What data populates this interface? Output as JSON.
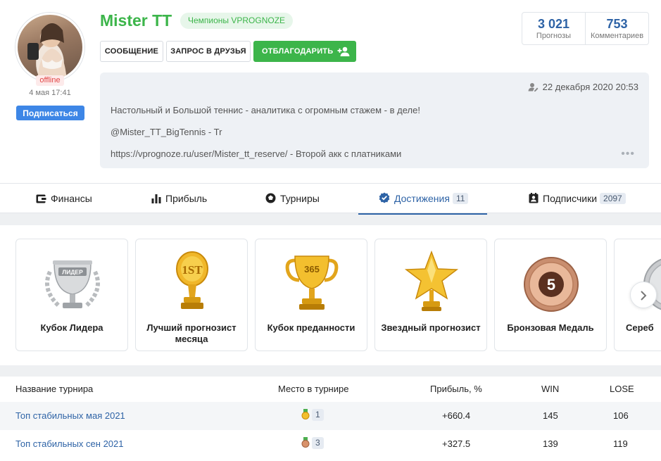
{
  "profile": {
    "username": "Mister TT",
    "status_badge": "Чемпионы VPROGNOZE",
    "online_status": "offline",
    "last_seen": "4 мая 17:41",
    "subscribe_label": "Подписаться",
    "buttons": {
      "message": "СООБЩЕНИЕ",
      "friend_request": "ЗАПРОС В ДРУЗЬЯ",
      "thank": "ОТБЛАГОДАРИТЬ"
    },
    "stats": [
      {
        "value": "3 021",
        "label": "Прогнозы"
      },
      {
        "value": "753",
        "label": "Комментариев"
      }
    ],
    "about": {
      "date": "22 декабря 2020 20:53",
      "lines": [
        "Настольный и Большой теннис - аналитика с огромным стажем - в деле!",
        "@Mister_TT_BigTennis - Tr",
        "https://vprognoze.ru/user/Mister_tt_reserve/ - Второй акк с платниками"
      ],
      "more": "•••"
    }
  },
  "tabs": [
    {
      "label": "Финансы",
      "icon": "wallet-icon"
    },
    {
      "label": "Прибыль",
      "icon": "bar-chart-icon"
    },
    {
      "label": "Турниры",
      "icon": "soccer-ball-icon"
    },
    {
      "label": "Достижения",
      "icon": "verified-badge-icon",
      "count": "11",
      "active": true
    },
    {
      "label": "Подписчики",
      "icon": "contact-card-icon",
      "count": "2097"
    }
  ],
  "achievements": [
    {
      "name": "Кубок Лидера",
      "icon": "silver-leader-cup-icon"
    },
    {
      "name": "Лучший прогнозист месяца",
      "icon": "gold-1st-trophy-icon"
    },
    {
      "name": "Кубок преданности",
      "icon": "gold-365-cup-icon"
    },
    {
      "name": "Звездный прогнозист",
      "icon": "gold-star-trophy-icon"
    },
    {
      "name": "Бронзовая Медаль",
      "icon": "bronze-medal-5-icon"
    },
    {
      "name": "Сереб",
      "icon": "silver-medal-icon"
    }
  ],
  "achievement_labels": {
    "leader_cup_text": "ЛИДЕР",
    "first_text": "1ST",
    "cup_365": "365",
    "medal_number": "5"
  },
  "tournament_table": {
    "headers": [
      "Название турнира",
      "Место в турнире",
      "Прибыль, %",
      "WIN",
      "LOSE"
    ],
    "rows": [
      {
        "name": "Топ стабильных мая 2021",
        "place": "1",
        "medal": "gold",
        "profit": "+660.4",
        "win": "145",
        "lose": "106"
      },
      {
        "name": "Топ стабильных сен 2021",
        "place": "3",
        "medal": "bronze",
        "profit": "+327.5",
        "win": "139",
        "lose": "119"
      }
    ]
  },
  "colors": {
    "accent_green": "#3cb54a",
    "accent_blue": "#2e63a6",
    "subscribe_blue": "#3d86e6",
    "offline_red": "#e14545"
  }
}
